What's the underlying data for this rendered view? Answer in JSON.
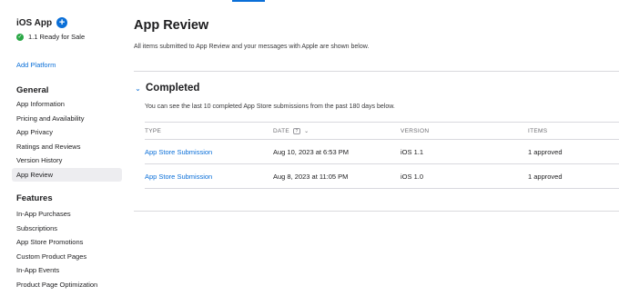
{
  "sidebar": {
    "app_name": "iOS App",
    "add_button_label": "+",
    "status": {
      "check": "✓",
      "text": "1.1 Ready for Sale"
    },
    "add_platform": "Add Platform",
    "general": {
      "title": "General",
      "items": [
        {
          "label": "App Information"
        },
        {
          "label": "Pricing and Availability"
        },
        {
          "label": "App Privacy"
        },
        {
          "label": "Ratings and Reviews"
        },
        {
          "label": "Version History"
        },
        {
          "label": "App Review"
        }
      ]
    },
    "features": {
      "title": "Features",
      "items": [
        {
          "label": "In-App Purchases"
        },
        {
          "label": "Subscriptions"
        },
        {
          "label": "App Store Promotions"
        },
        {
          "label": "Custom Product Pages"
        },
        {
          "label": "In-App Events"
        },
        {
          "label": "Product Page Optimization"
        }
      ]
    }
  },
  "main": {
    "title": "App Review",
    "description": "All items submitted to App Review and your messages with Apple are shown below.",
    "completed": {
      "chevron": "⌄",
      "title": "Completed",
      "description": "You can see the last 10 completed App Store submissions from the past 180 days below.",
      "table": {
        "headers": {
          "type": "TYPE",
          "date": "DATE",
          "date_help": "?",
          "date_sort": "⌄",
          "version": "VERSION",
          "items": "ITEMS"
        },
        "rows": [
          {
            "type": "App Store Submission",
            "date": "Aug 10, 2023 at 6:53 PM",
            "version": "iOS 1.1",
            "items": "1 approved"
          },
          {
            "type": "App Store Submission",
            "date": "Aug 8, 2023 at 11:05 PM",
            "version": "iOS 1.0",
            "items": "1 approved"
          }
        ]
      }
    }
  },
  "colors": {
    "accent": "#0a6fd8",
    "status_green": "#29a745",
    "active_nav_bg": "#ededf0"
  }
}
